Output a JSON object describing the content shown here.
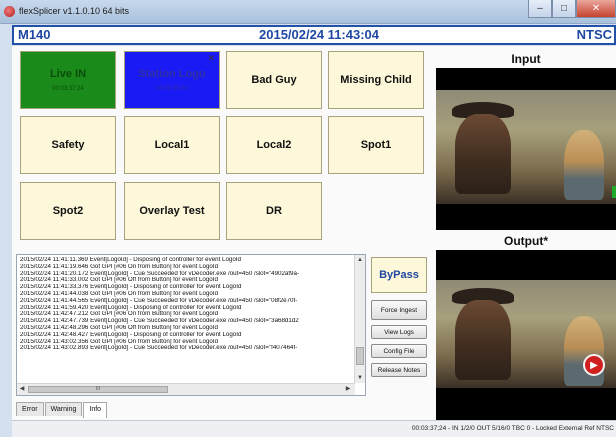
{
  "window": {
    "title": "flexSplicer v1.1.0.10 64 bits",
    "minimize": "–",
    "maximize": "□",
    "close": "✕"
  },
  "header": {
    "station": "M140",
    "datetime": "2015/02/24 11:43:04",
    "format": "NTSC"
  },
  "events": [
    {
      "label": "Live IN",
      "sub": "00:03:37:24",
      "color": "#1a8a1a"
    },
    {
      "label": "Station Logo",
      "sub": "00:00:00:00",
      "color": "#1a1af5",
      "corner": "✕"
    },
    {
      "label": "Bad Guy"
    },
    {
      "label": "Missing Child"
    },
    {
      "label": "Safety"
    },
    {
      "label": "Local1"
    },
    {
      "label": "Local2"
    },
    {
      "label": "Spot1"
    },
    {
      "label": "Spot2"
    },
    {
      "label": "Overlay Test"
    },
    {
      "label": "DR"
    }
  ],
  "video": {
    "input_label": "Input",
    "output_label": "Output*"
  },
  "log": {
    "lines": [
      "2015/02/24 11:41:11.369 Event[LogoId] - Disposing of controller for event LogoId",
      "2015/02/24 11:41:19.646 Got GPI [#06 On from Button] for event LogoId",
      "2015/02/24 11:41:20.172 Event[LogoId] - Cue Succeeded for vDecoder.exe   /out=450 /slot=\"4902af9a-",
      "2015/02/24 11:41:33.002 Got GPI [#06 Off from Button] for event LogoId",
      "2015/02/24 11:41:33.376 Event[LogoId] - Disposing of controller for event LogoId",
      "2015/02/24 11:41:44.038 Got GPI [#06 On from Button] for event LogoId",
      "2015/02/24 11:41:44.565 Event[LogoId] - Cue Succeeded for vDecoder.exe   /out=450 /slot=\"08f2e70f-",
      "2015/02/24 11:41:59.420 Event[LogoId] - Disposing of controller for event LogoId",
      "2015/02/24 11:42:47.212 Got GPI [#06 On from Button] for event LogoId",
      "2015/02/24 11:42:47.739 Event[LogoId] - Cue Succeeded for vDecoder.exe   /out=450 /slot=\"3a68d1d2",
      "2015/02/24 11:42:48.296 Got GPI [#06 Off from Button] for event LogoId",
      "2015/02/24 11:42:48.427 Event[LogoId] - Disposing of controller for event LogoId",
      "2015/02/24 11:43:02.356 Got GPI [#06 On from Button] for event LogoId",
      "2015/02/24 11:43:02.893 Event[LogoId] - Cue Succeeded for vDecoder.exe   /out=450 /slot=\"f407464f-"
    ],
    "hscroll_thumb": "III"
  },
  "tabs": [
    {
      "label": "Error",
      "active": false
    },
    {
      "label": "Warning",
      "active": false
    },
    {
      "label": "Info",
      "active": true
    }
  ],
  "side_buttons": {
    "bypass": "ByPass",
    "force_ingest": "Force Ingest",
    "view_logs": "View Logs",
    "config_file": "Config File",
    "release_notes": "Release Notes"
  },
  "status": {
    "text": "00:03:37;24 - IN 1/2/0 OUT 5/16/0 TBC 0 - Locked External Ref NTSC"
  },
  "colors": {
    "header_blue": "#1f47a3",
    "live_green": "#1a8a1a",
    "logo_blue": "#1a1af5",
    "event_cream": "#fdf8d9"
  }
}
